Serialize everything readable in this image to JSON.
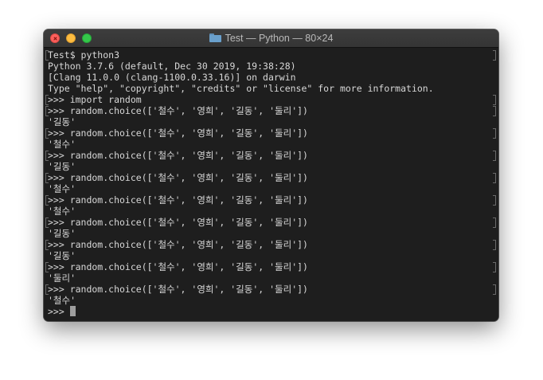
{
  "window": {
    "title": "Test — Python — 80×24",
    "icon": "folder-icon"
  },
  "terminal": {
    "lines": [
      {
        "text": "Test$ python3",
        "mark": true
      },
      {
        "text": "Python 3.7.6 (default, Dec 30 2019, 19:38:28)",
        "mark": false
      },
      {
        "text": "[Clang 11.0.0 (clang-1100.0.33.16)] on darwin",
        "mark": false
      },
      {
        "text": "Type \"help\", \"copyright\", \"credits\" or \"license\" for more information.",
        "mark": false
      },
      {
        "text": ">>> import random",
        "mark": true
      },
      {
        "text": ">>> random.choice(['철수', '영희', '길동', '둘리'])",
        "mark": true
      },
      {
        "text": "'길동'",
        "mark": false
      },
      {
        "text": ">>> random.choice(['철수', '영희', '길동', '둘리'])",
        "mark": true
      },
      {
        "text": "'철수'",
        "mark": false
      },
      {
        "text": ">>> random.choice(['철수', '영희', '길동', '둘리'])",
        "mark": true
      },
      {
        "text": "'길동'",
        "mark": false
      },
      {
        "text": ">>> random.choice(['철수', '영희', '길동', '둘리'])",
        "mark": true
      },
      {
        "text": "'철수'",
        "mark": false
      },
      {
        "text": ">>> random.choice(['철수', '영희', '길동', '둘리'])",
        "mark": true
      },
      {
        "text": "'철수'",
        "mark": false
      },
      {
        "text": ">>> random.choice(['철수', '영희', '길동', '둘리'])",
        "mark": true
      },
      {
        "text": "'길동'",
        "mark": false
      },
      {
        "text": ">>> random.choice(['철수', '영희', '길동', '둘리'])",
        "mark": true
      },
      {
        "text": "'길동'",
        "mark": false
      },
      {
        "text": ">>> random.choice(['철수', '영희', '길동', '둘리'])",
        "mark": true
      },
      {
        "text": "'둘리'",
        "mark": false
      },
      {
        "text": ">>> random.choice(['철수', '영희', '길동', '둘리'])",
        "mark": true
      },
      {
        "text": "'철수'",
        "mark": false
      }
    ],
    "prompt": ">>> "
  }
}
